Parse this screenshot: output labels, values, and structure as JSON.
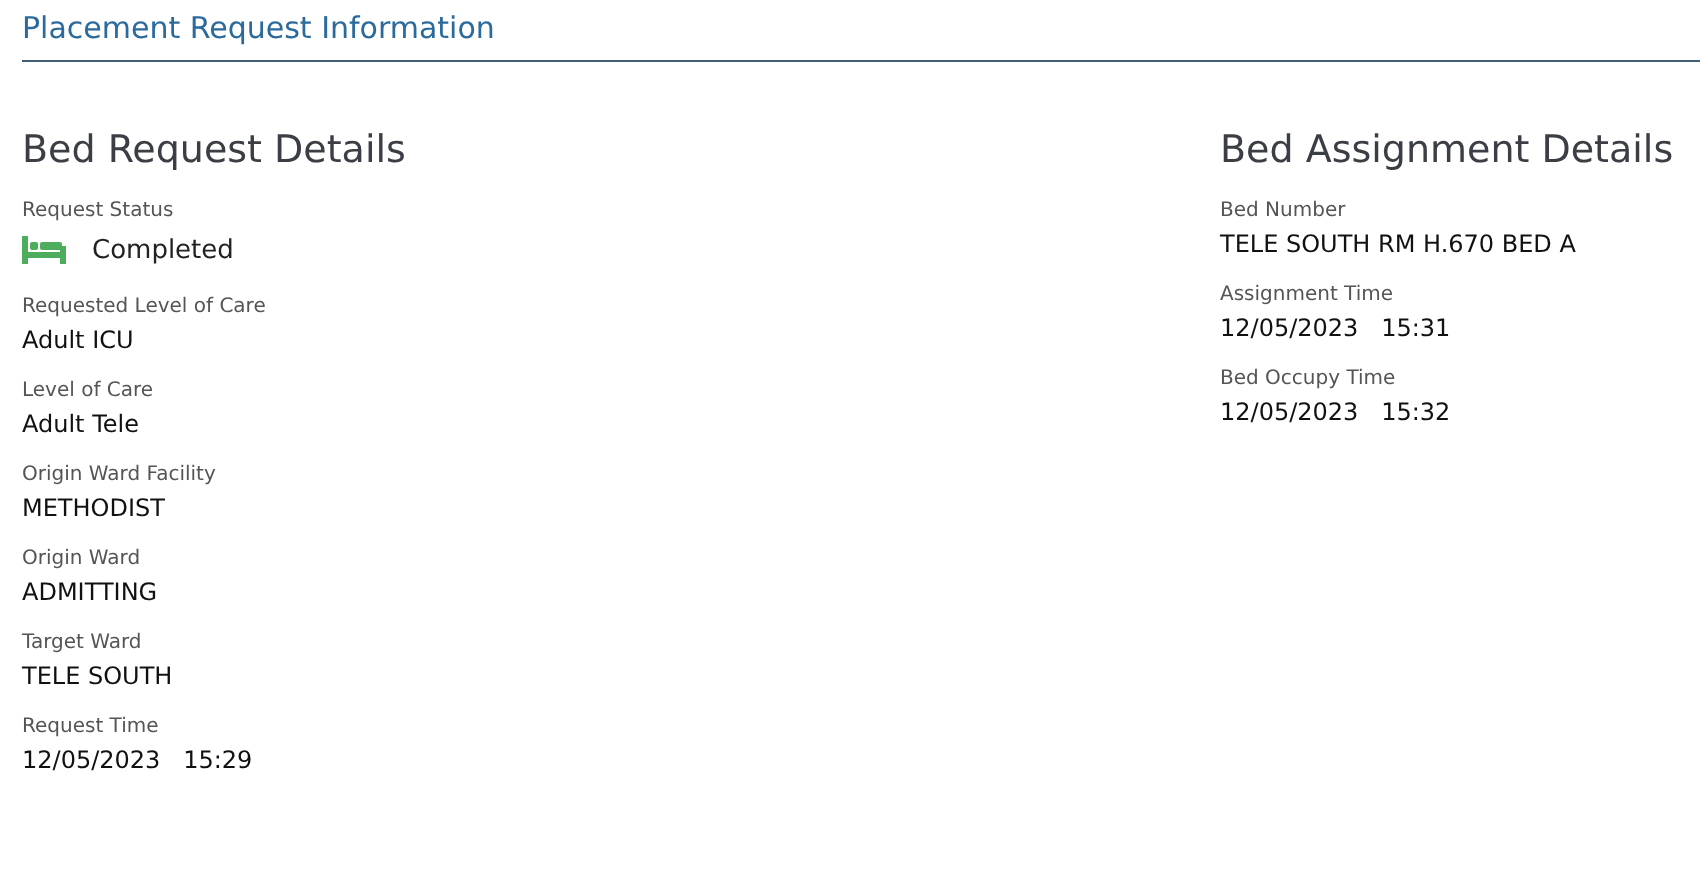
{
  "header": {
    "title": "Placement Request Information"
  },
  "sections": [
    {
      "title": "Bed Request Details",
      "fields": [
        {
          "kind": "status",
          "label": "Request Status",
          "value": "Completed"
        },
        {
          "kind": "text",
          "label": "Requested Level of Care",
          "value": "Adult ICU"
        },
        {
          "kind": "text",
          "label": "Level of Care",
          "value": "Adult Tele"
        },
        {
          "kind": "text",
          "label": "Origin Ward Facility",
          "value": "METHODIST"
        },
        {
          "kind": "text",
          "label": "Origin Ward",
          "value": "ADMITTING"
        },
        {
          "kind": "text",
          "label": "Target Ward",
          "value": "TELE SOUTH"
        },
        {
          "kind": "text",
          "label": "Request Time",
          "value": "12/05/2023   15:29"
        }
      ]
    },
    {
      "title": "Bed Assignment Details",
      "fields": [
        {
          "kind": "text",
          "label": "Bed Number",
          "value": "TELE SOUTH RM H.670 BED A"
        },
        {
          "kind": "text",
          "label": "Assignment Time",
          "value": "12/05/2023   15:31"
        },
        {
          "kind": "text",
          "label": "Bed Occupy Time",
          "value": "12/05/2023   15:32"
        }
      ]
    }
  ]
}
